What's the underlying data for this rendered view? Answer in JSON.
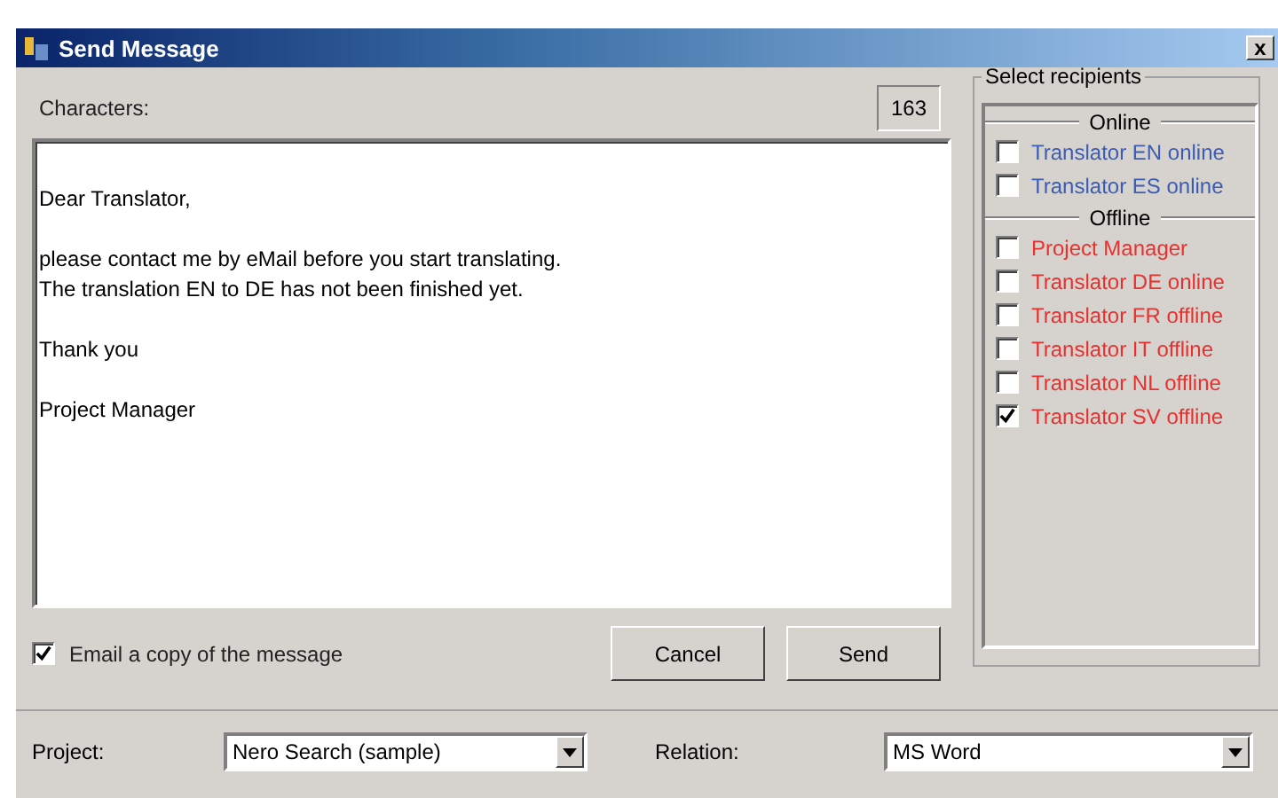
{
  "window": {
    "title": "Send Message",
    "close": "x"
  },
  "characters": {
    "label": "Characters:",
    "count": "163"
  },
  "message": {
    "paragraphs": [
      [
        "Dear Translator,"
      ],
      [
        "please contact me by eMail before you start translating.",
        "The translation EN to DE has not been finished yet."
      ],
      [
        "Thank you"
      ],
      [
        "Project Manager"
      ]
    ]
  },
  "copy_option": {
    "label": "Email a copy of the message",
    "checked": true
  },
  "buttons": [
    "Cancel",
    "Send"
  ],
  "recipients": {
    "title": "Select recipients",
    "groups": [
      {
        "title": "Online",
        "items": [
          {
            "label": "Translator EN online",
            "checked": false,
            "color": "#3b5cb4"
          },
          {
            "label": "Translator ES online",
            "checked": false,
            "color": "#3b5cb4"
          }
        ]
      },
      {
        "title": "Offline",
        "items": [
          {
            "label": "Project Manager",
            "checked": false,
            "color": "#e8312f"
          },
          {
            "label": "Translator DE online",
            "checked": false,
            "color": "#e8312f"
          },
          {
            "label": "Translator FR offline",
            "checked": false,
            "color": "#e8312f"
          },
          {
            "label": "Translator IT offline",
            "checked": false,
            "color": "#e8312f"
          },
          {
            "label": "Translator NL offline",
            "checked": false,
            "color": "#e8312f"
          },
          {
            "label": "Translator SV offline",
            "checked": true,
            "color": "#e8312f"
          }
        ]
      }
    ]
  },
  "footer": {
    "project": {
      "label": "Project:",
      "value": "Nero Search (sample)"
    },
    "relation": {
      "label": "Relation:",
      "value": "MS Word"
    }
  }
}
